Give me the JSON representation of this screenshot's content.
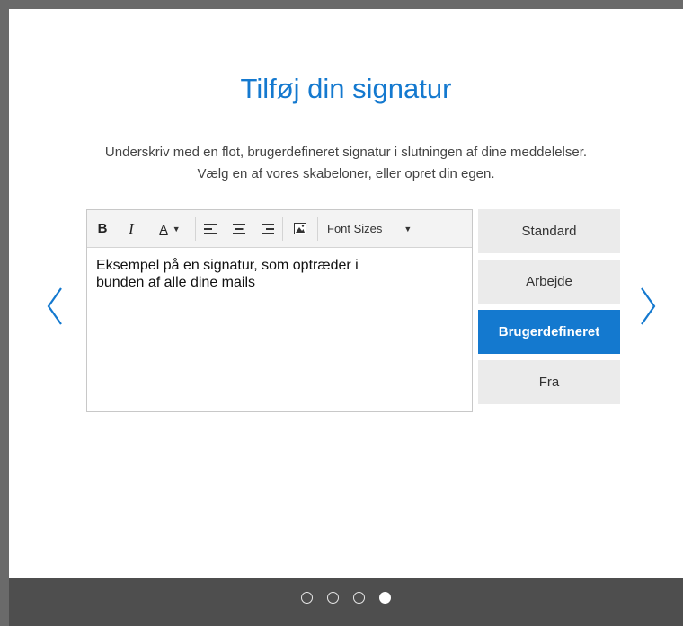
{
  "dialog": {
    "title": "Tilføj din signatur",
    "subtitle_line1": "Underskriv med en flot, brugerdefineret signatur i slutningen af dine meddelelser.",
    "subtitle_line2": "Vælg en af vores skabeloner, eller opret din egen."
  },
  "toolbar": {
    "bold_label": "B",
    "italic_label": "I",
    "font_color_label": "A",
    "font_sizes_label": "Font Sizes"
  },
  "editor": {
    "content_line1": "Eksempel på en signatur, som optræder i",
    "content_line2": "bunden af alle dine mails"
  },
  "templates": [
    {
      "label": "Standard",
      "selected": false
    },
    {
      "label": "Arbejde",
      "selected": false
    },
    {
      "label": "Brugerdefineret",
      "selected": true
    },
    {
      "label": "Fra",
      "selected": false
    }
  ],
  "pagination": {
    "total": 4,
    "current": 4
  },
  "colors": {
    "accent": "#1479cf",
    "template_bg": "#ebebeb",
    "footer_bg": "#4e4e4e"
  },
  "icons": {
    "prev": "chevron-left-icon",
    "next": "chevron-right-icon",
    "align_left": "align-left-icon",
    "align_center": "align-center-icon",
    "align_right": "align-right-icon",
    "image": "image-icon"
  }
}
